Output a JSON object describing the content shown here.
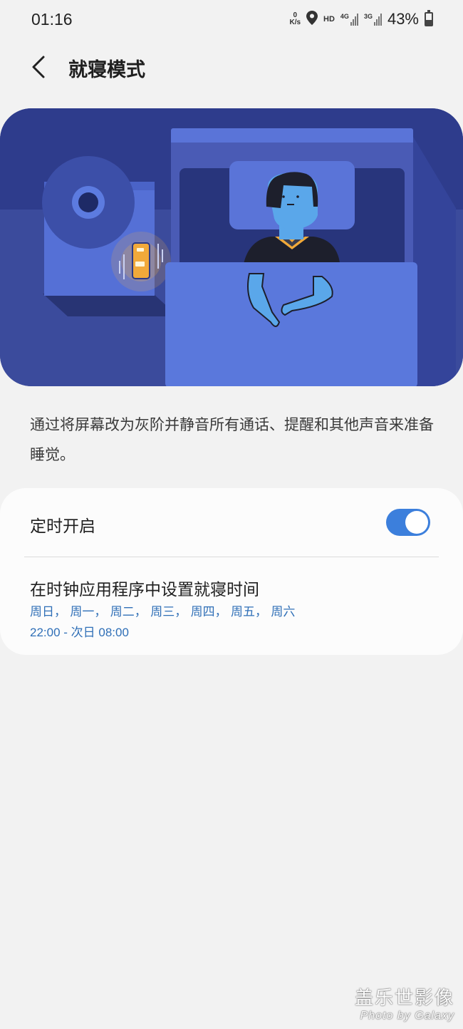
{
  "status_bar": {
    "time": "01:16",
    "net_speed_value": "0",
    "net_speed_unit": "K/s",
    "hd_label": "HD",
    "signal1_label": "4G",
    "signal2_label": "3G",
    "battery_percent": "43%",
    "battery_level": 0.43,
    "icons": [
      "location-icon",
      "signal-icon",
      "battery-icon"
    ]
  },
  "header": {
    "back_icon": "chevron-left-icon",
    "title": "就寝模式"
  },
  "illustration": {
    "name": "person-sleeping-with-phone-illustration",
    "colors": {
      "background": "#2c3a86",
      "wall": "#2e3c8c",
      "floor": "#3b4b9c",
      "bed_frame": "#4a5bb5",
      "blanket": "#5b77d8",
      "skin": "#5aa7ea",
      "phone": "#f1a93a"
    }
  },
  "description": "通过将屏幕改为灰阶并静音所有通话、提醒和其他声音来准备睡觉。",
  "settings": {
    "scheduled_label": "定时开启",
    "scheduled_enabled": true,
    "accent_color": "#3c7fdc",
    "clock_row": {
      "title": "在时钟应用程序中设置就寝时间",
      "days": "周日， 周一， 周二， 周三， 周四， 周五， 周六",
      "time": "22:00 - 次日 08:00",
      "color": "#2f6fb7"
    }
  },
  "watermark": {
    "cn": "盖乐世影像",
    "en": "Photo by Galaxy"
  }
}
